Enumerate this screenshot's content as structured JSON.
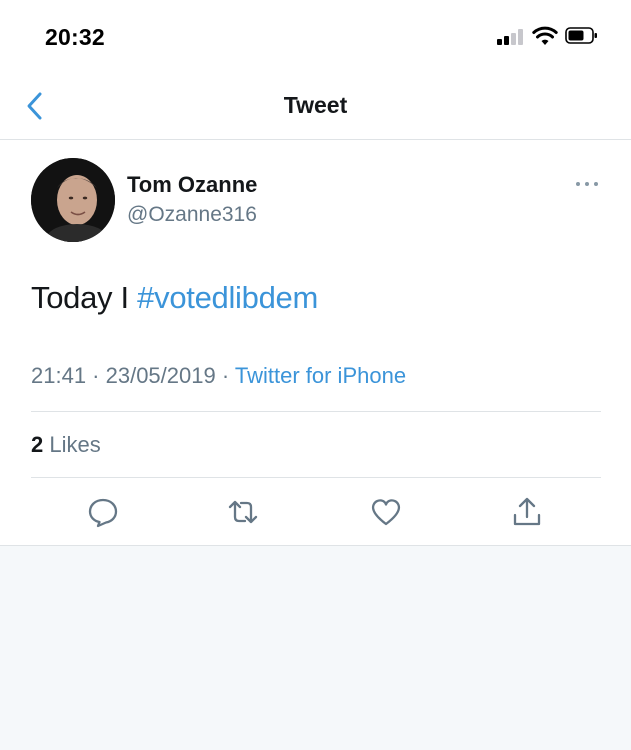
{
  "status_bar": {
    "time": "20:32"
  },
  "nav": {
    "title": "Tweet"
  },
  "tweet": {
    "author_name": "Tom Ozanne",
    "author_handle": "@Ozanne316",
    "text_prefix": "Today I ",
    "hashtag": "#votedlibdem",
    "timestamp": "21:41 · 23/05/2019",
    "separator": " · ",
    "source": "Twitter for iPhone",
    "likes_count": "2",
    "likes_label": " Likes"
  },
  "colors": {
    "link": "#3b94d9",
    "secondary": "#657786",
    "divider": "#dfe3e6"
  },
  "icons": [
    "chevron-left-icon",
    "more-icon",
    "reply-icon",
    "retweet-icon",
    "like-icon",
    "share-icon"
  ]
}
